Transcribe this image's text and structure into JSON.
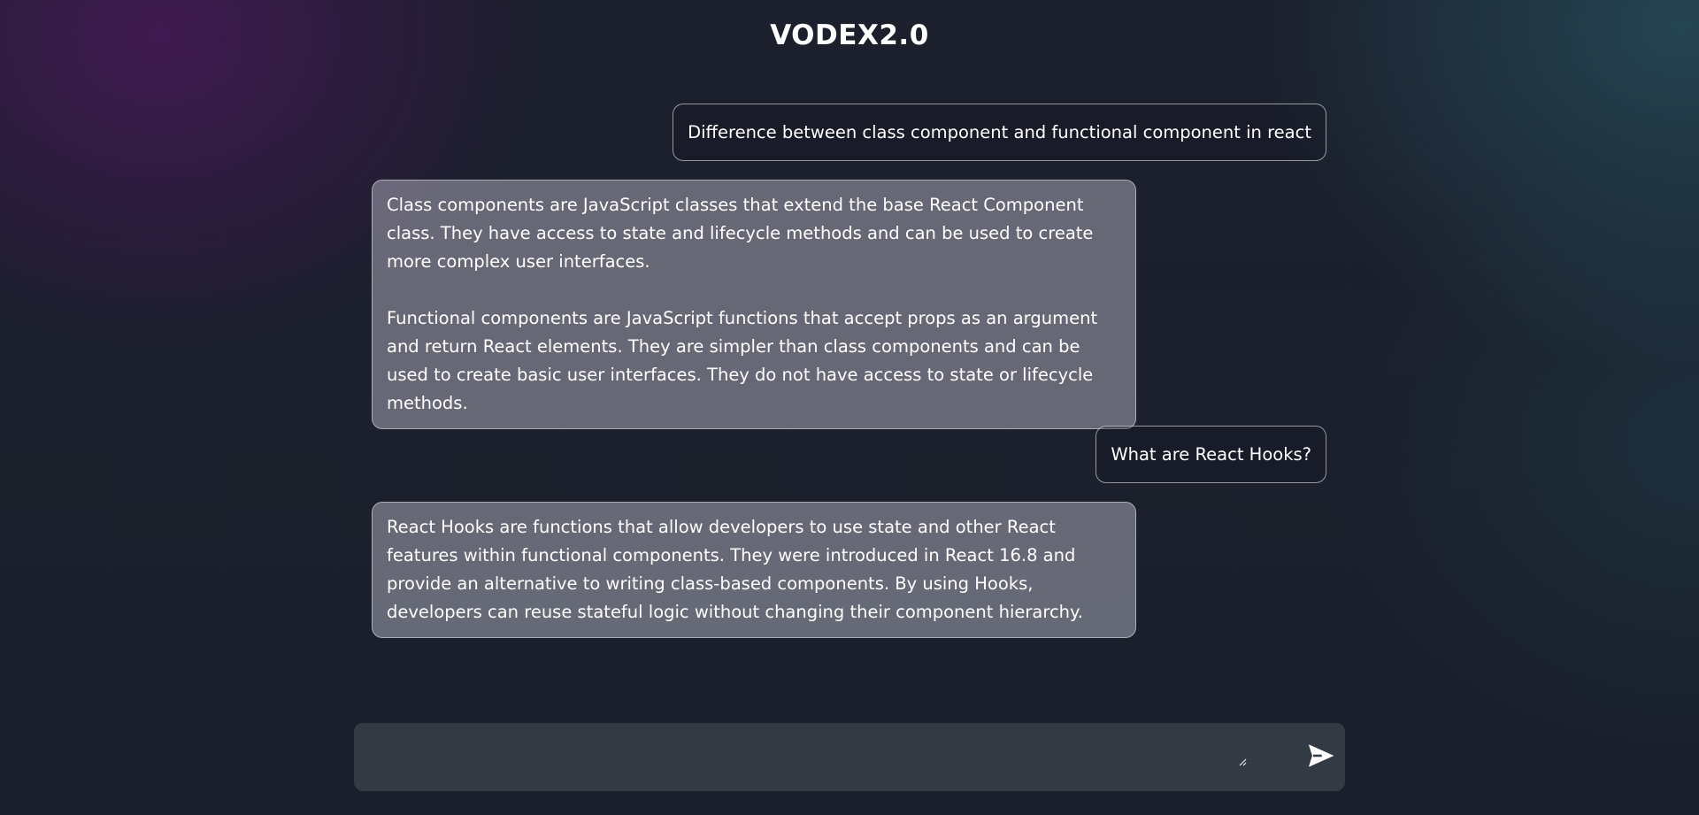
{
  "app": {
    "title": "VODEX2.0"
  },
  "messages": [
    {
      "role": "user",
      "text": "Difference between class component and functional component in react"
    },
    {
      "role": "bot",
      "paragraphs": [
        "Class components are JavaScript classes that extend the base React Component class. They have access to state and lifecycle methods and can be used to create more complex user interfaces.",
        "Functional components are JavaScript functions that accept props as an argument and return React elements. They are simpler than class components and can be used to create basic user interfaces. They do not have access to state or lifecycle methods."
      ]
    },
    {
      "role": "user",
      "text": "What are React Hooks?"
    },
    {
      "role": "bot",
      "paragraphs": [
        "React Hooks are functions that allow developers to use state and other React features within functional components. They were introduced in React 16.8 and provide an alternative to writing class-based components. By using Hooks, developers can reuse stateful logic without changing their component hierarchy."
      ]
    }
  ],
  "composer": {
    "value": "",
    "placeholder": "",
    "send_icon": "send-icon"
  },
  "colors": {
    "composer_background": "#343a44",
    "bot_bubble": "#8a8a96",
    "user_bubble_border": "#b4b6bc"
  }
}
